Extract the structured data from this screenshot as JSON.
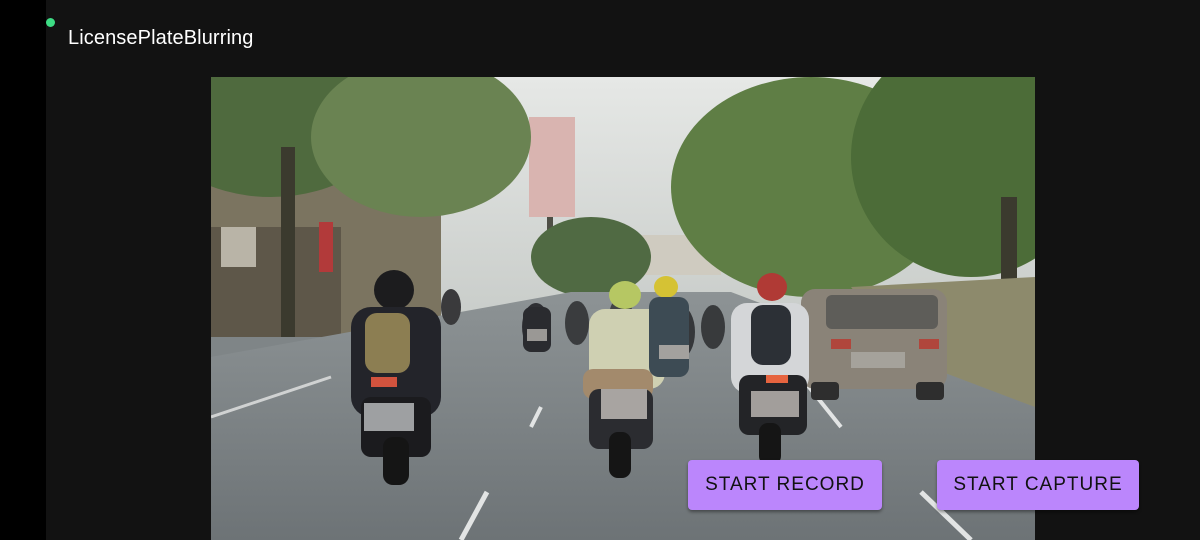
{
  "app": {
    "title": "LicensePlateBlurring",
    "status_indicator_color": "#3ddc84"
  },
  "camera": {
    "scene": "street-traffic-motorcycles",
    "blurred_plates": 5
  },
  "actions": {
    "record_label": "START RECORD",
    "capture_label": "START CAPTURE",
    "button_color": "#bb86fc"
  }
}
